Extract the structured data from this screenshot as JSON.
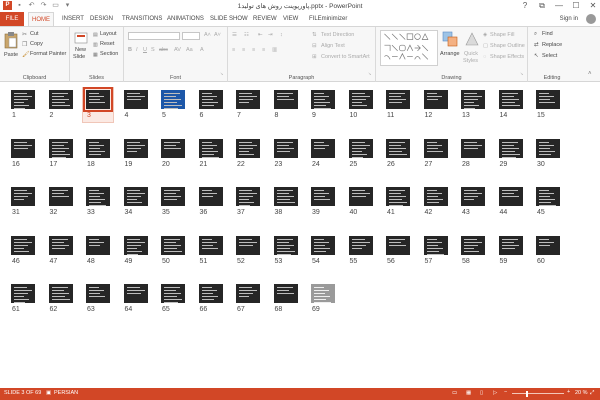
{
  "window": {
    "title": "پاورپوینت روش های تولید1.pptx - PowerPoint",
    "controls": [
      "?",
      "⧉",
      "—",
      "☐",
      "✕"
    ]
  },
  "tabs": [
    "FILE",
    "HOME",
    "INSERT",
    "DESIGN",
    "TRANSITIONS",
    "ANIMATIONS",
    "SLIDE SHOW",
    "REVIEW",
    "VIEW",
    "FILEminimizer"
  ],
  "active_tab": "HOME",
  "sign_in": "Sign in",
  "ribbon": {
    "clipboard": {
      "label": "Clipboard",
      "paste": "Paste",
      "cut": "Cut",
      "copy": "Copy",
      "format_painter": "Format Painter"
    },
    "slides": {
      "label": "Slides",
      "new_slide_1": "New",
      "new_slide_2": "Slide",
      "layout": "Layout",
      "reset": "Reset",
      "section": "Section"
    },
    "font": {
      "label": "Font"
    },
    "paragraph": {
      "label": "Paragraph",
      "text_direction": "Text Direction",
      "align_text": "Align Text",
      "convert_smartart": "Convert to SmartArt"
    },
    "drawing": {
      "label": "Drawing",
      "arrange": "Arrange",
      "quick_styles_1": "Quick",
      "quick_styles_2": "Styles",
      "shape_fill": "Shape Fill",
      "shape_outline": "Shape Outline",
      "shape_effects": "Shape Effects"
    },
    "editing": {
      "label": "Editing",
      "find": "Find",
      "replace": "Replace",
      "select": "Select"
    }
  },
  "slides": {
    "total": 69,
    "selected": 3,
    "special": {
      "5": "blue",
      "69": "light"
    }
  },
  "status": {
    "slide_info": "SLIDE 3 OF 69",
    "language": "PERSIAN",
    "zoom": "20 %",
    "zoom_level_fraction": 0.27
  }
}
